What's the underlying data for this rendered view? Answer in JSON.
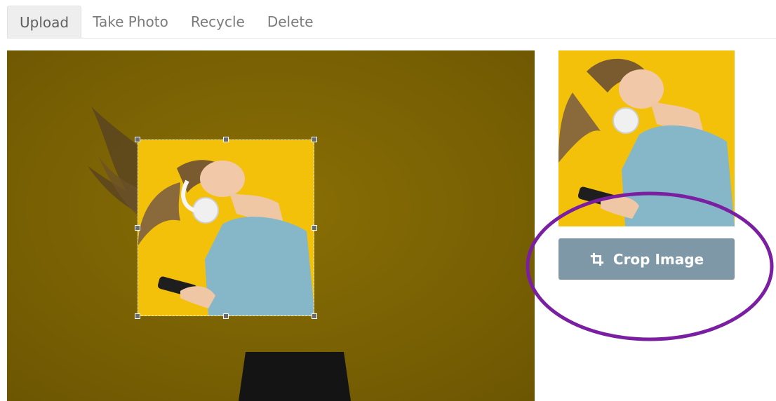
{
  "tabs": [
    {
      "label": "Upload",
      "active": true
    },
    {
      "label": "Take Photo",
      "active": false
    },
    {
      "label": "Recycle",
      "active": false
    },
    {
      "label": "Delete",
      "active": false
    }
  ],
  "crop_button": {
    "label": "Crop Image",
    "icon": "crop-icon",
    "color": "#7f98a8"
  },
  "colors": {
    "photo_background": "#7b6303",
    "selection_background": "#f4c10a",
    "annotation": "#7b1fa2"
  }
}
